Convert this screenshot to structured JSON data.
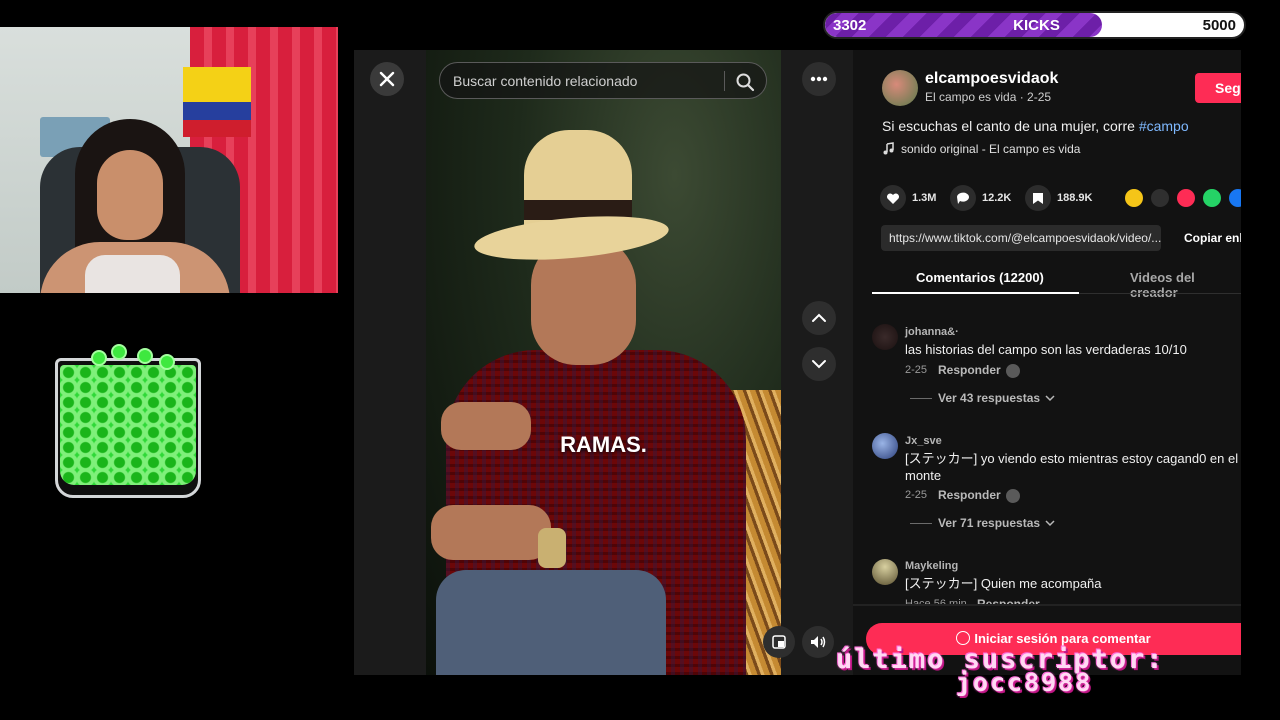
{
  "kicks": {
    "current": "3302",
    "label": "KICKS",
    "goal": "5000",
    "progress": 0.6604,
    "fill_color": "#7a2bb8"
  },
  "search": {
    "placeholder": "Buscar contenido relacionado",
    "icon": "search-icon"
  },
  "video": {
    "caption": "RAMAS."
  },
  "controls": {
    "close_icon": "close-icon",
    "more_icon": "more-icon",
    "up_icon": "chevron-up-icon",
    "down_icon": "chevron-down-icon",
    "float_icon": "floating-player-icon",
    "volume_icon": "volume-icon"
  },
  "post": {
    "author": "elcampoesvidaok",
    "meta": "El campo es vida · 2-25",
    "follow_label": "Seg",
    "description": "Si escuchas el canto de una mujer, corre ",
    "hashtag": "#campo",
    "sound": "sonido original - El campo es vida",
    "likes": "1.3M",
    "comments": "12.2K",
    "saves": "188.9K",
    "url": "https://www.tiktok.com/@elcampoesvidaok/video/...",
    "copy_label": "Copiar enl",
    "share_colors": [
      "#f5c518",
      "#2f2f2f",
      "#fe2c55",
      "#25d366",
      "#1877f2"
    ]
  },
  "tabs": {
    "comments": "Comentarios (12200)",
    "creator_videos": "Videos del creador"
  },
  "comments": [
    {
      "user": "johanna&·",
      "text": "las historias del campo son las verdaderas 10/10",
      "date": "2-25",
      "reply": "Responder",
      "more": "Ver 43 respuestas"
    },
    {
      "user": "Jx_sve",
      "text": "[ステッカー] yo viendo esto mientras estoy cagand0 en el monte",
      "date": "2-25",
      "reply": "Responder",
      "more": "Ver 71 respuestas"
    },
    {
      "user": "Maykeling",
      "text": "[ステッカー] Quien me acompaña",
      "date": "Hace 56 min",
      "reply": "Responder"
    }
  ],
  "login_prompt": "Iniciar sesión para comentar",
  "overlay": {
    "last_sub_label": "último suscriptor:",
    "last_sub_name": "jocc8988"
  }
}
